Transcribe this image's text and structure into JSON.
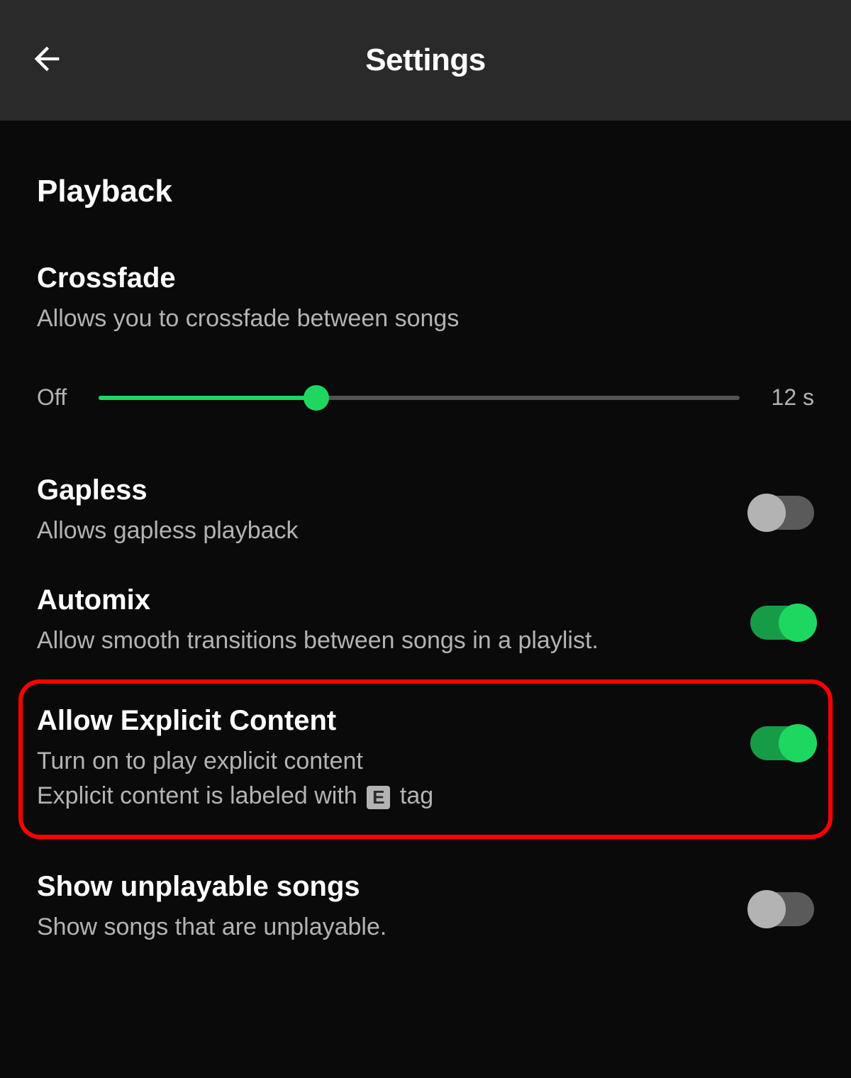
{
  "header": {
    "title": "Settings"
  },
  "section": {
    "title": "Playback"
  },
  "crossfade": {
    "title": "Crossfade",
    "desc": "Allows you to crossfade between songs",
    "left_label": "Off",
    "right_label": "12 s",
    "fill_percent": 34
  },
  "gapless": {
    "title": "Gapless",
    "desc": "Allows gapless playback",
    "on": false
  },
  "automix": {
    "title": "Automix",
    "desc": "Allow smooth transitions between songs in a playlist.",
    "on": true
  },
  "explicit": {
    "title": "Allow Explicit Content",
    "desc1": "Turn on to play explicit content",
    "desc2_pre": "Explicit content is labeled with ",
    "badge": "E",
    "desc2_post": " tag",
    "on": true
  },
  "unplayable": {
    "title": "Show unplayable songs",
    "desc": "Show songs that are unplayable.",
    "on": false
  }
}
